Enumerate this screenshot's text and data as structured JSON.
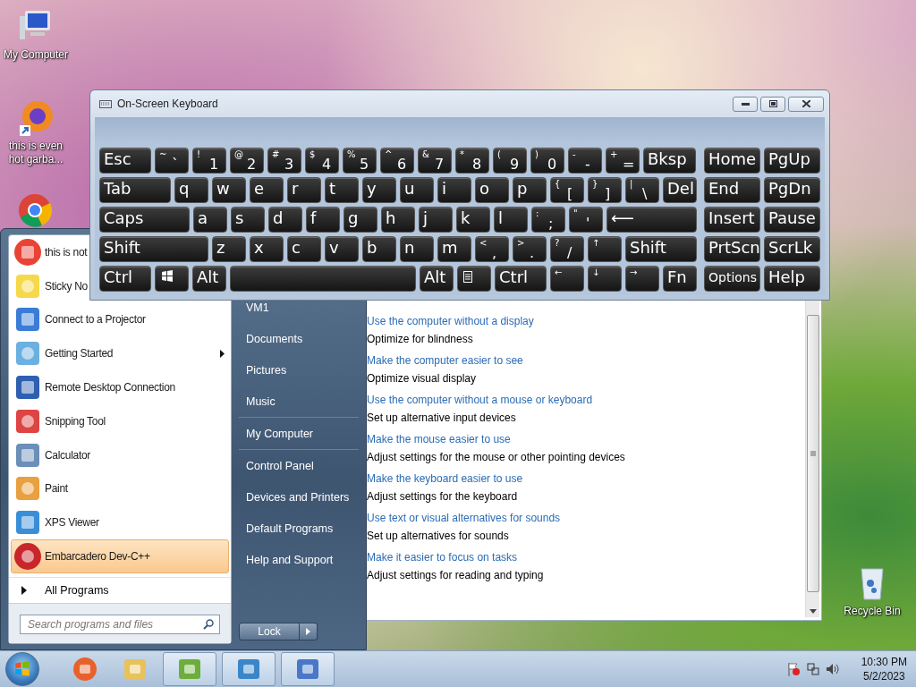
{
  "desktop": {
    "icons": [
      {
        "label": "My Computer"
      },
      {
        "label": "this is even hot garba..."
      },
      {
        "label": "Recycle Bin"
      }
    ]
  },
  "accessibility_window": {
    "items": [
      {
        "link": "Use the computer without a display",
        "description": "Optimize for blindness"
      },
      {
        "link": "Make the computer easier to see",
        "description": "Optimize visual display"
      },
      {
        "link": "Use the computer without a mouse or keyboard",
        "description": "Set up alternative input devices"
      },
      {
        "link": "Make the mouse easier to use",
        "description": "Adjust settings for the mouse or other pointing devices"
      },
      {
        "link": "Make the keyboard easier to use",
        "description": "Adjust settings for the keyboard"
      },
      {
        "link": "Use text or visual alternatives for sounds",
        "description": "Set up alternatives for sounds"
      },
      {
        "link": "Make it easier to focus on tasks",
        "description": "Adjust settings for reading and typing"
      }
    ]
  },
  "start_menu": {
    "programs": [
      {
        "label": "this is not",
        "selected": false,
        "has_submenu": false
      },
      {
        "label": "Sticky No",
        "selected": false,
        "has_submenu": false
      },
      {
        "label": "Connect to a Projector",
        "selected": false,
        "has_submenu": false
      },
      {
        "label": "Getting Started",
        "selected": false,
        "has_submenu": true
      },
      {
        "label": "Remote Desktop Connection",
        "selected": false,
        "has_submenu": false
      },
      {
        "label": "Snipping Tool",
        "selected": false,
        "has_submenu": false
      },
      {
        "label": "Calculator",
        "selected": false,
        "has_submenu": false
      },
      {
        "label": "Paint",
        "selected": false,
        "has_submenu": false
      },
      {
        "label": "XPS Viewer",
        "selected": false,
        "has_submenu": false
      },
      {
        "label": "Embarcadero Dev-C++",
        "selected": true,
        "has_submenu": false
      }
    ],
    "all_programs": "All Programs",
    "search": {
      "placeholder": "Search programs and files"
    },
    "places": [
      {
        "label": "VM1",
        "separator_before": false
      },
      {
        "label": "Documents",
        "separator_before": false
      },
      {
        "label": "Pictures",
        "separator_before": false
      },
      {
        "label": "Music",
        "separator_before": false
      },
      {
        "label": "My Computer",
        "separator_before": true
      },
      {
        "label": "Control Panel",
        "separator_before": true
      },
      {
        "label": "Devices and Printers",
        "separator_before": false
      },
      {
        "label": "Default Programs",
        "separator_before": false
      },
      {
        "label": "Help and Support",
        "separator_before": false
      }
    ],
    "lock_button": "Lock"
  },
  "keyboard_window": {
    "title": "On-Screen Keyboard",
    "main_rows": [
      [
        {
          "kind": "text",
          "label": "Esc"
        },
        {
          "kind": "dual",
          "shift": "~",
          "label": "`"
        },
        {
          "kind": "dual",
          "shift": "!",
          "label": "1"
        },
        {
          "kind": "dual",
          "shift": "@",
          "label": "2"
        },
        {
          "kind": "dual",
          "shift": "#",
          "label": "3"
        },
        {
          "kind": "dual",
          "shift": "$",
          "label": "4"
        },
        {
          "kind": "dual",
          "shift": "%",
          "label": "5"
        },
        {
          "kind": "dual",
          "shift": "^",
          "label": "6"
        },
        {
          "kind": "dual",
          "shift": "&",
          "label": "7"
        },
        {
          "kind": "dual",
          "shift": "*",
          "label": "8"
        },
        {
          "kind": "dual",
          "shift": "(",
          "label": "9"
        },
        {
          "kind": "dual",
          "shift": ")",
          "label": "0"
        },
        {
          "kind": "dual",
          "shift": "-",
          "label": "-"
        },
        {
          "kind": "dual",
          "shift": "+",
          "label": "="
        },
        {
          "kind": "text",
          "label": "Bksp"
        }
      ],
      [
        {
          "kind": "text",
          "label": "Tab"
        },
        {
          "kind": "text",
          "label": "q"
        },
        {
          "kind": "text",
          "label": "w"
        },
        {
          "kind": "text",
          "label": "e"
        },
        {
          "kind": "text",
          "label": "r"
        },
        {
          "kind": "text",
          "label": "t"
        },
        {
          "kind": "text",
          "label": "y"
        },
        {
          "kind": "text",
          "label": "u"
        },
        {
          "kind": "text",
          "label": "i"
        },
        {
          "kind": "text",
          "label": "o"
        },
        {
          "kind": "text",
          "label": "p"
        },
        {
          "kind": "dual",
          "shift": "{",
          "label": "["
        },
        {
          "kind": "dual",
          "shift": "}",
          "label": "]"
        },
        {
          "kind": "dual",
          "shift": "|",
          "label": "\\"
        },
        {
          "kind": "text",
          "label": "Del"
        }
      ],
      [
        {
          "kind": "text",
          "label": "Caps"
        },
        {
          "kind": "text",
          "label": "a"
        },
        {
          "kind": "text",
          "label": "s"
        },
        {
          "kind": "text",
          "label": "d"
        },
        {
          "kind": "text",
          "label": "f"
        },
        {
          "kind": "text",
          "label": "g"
        },
        {
          "kind": "text",
          "label": "h"
        },
        {
          "kind": "text",
          "label": "j"
        },
        {
          "kind": "text",
          "label": "k"
        },
        {
          "kind": "text",
          "label": "l"
        },
        {
          "kind": "dual",
          "shift": ":",
          "label": ";"
        },
        {
          "kind": "dual",
          "shift": "\"",
          "label": "'"
        },
        {
          "kind": "text",
          "label": "⟵"
        }
      ],
      [
        {
          "kind": "text",
          "label": "Shift"
        },
        {
          "kind": "text",
          "label": "z"
        },
        {
          "kind": "text",
          "label": "x"
        },
        {
          "kind": "text",
          "label": "c"
        },
        {
          "kind": "text",
          "label": "v"
        },
        {
          "kind": "text",
          "label": "b"
        },
        {
          "kind": "text",
          "label": "n"
        },
        {
          "kind": "text",
          "label": "m"
        },
        {
          "kind": "dual",
          "shift": "<",
          "label": ","
        },
        {
          "kind": "dual",
          "shift": ">",
          "label": "."
        },
        {
          "kind": "dual",
          "shift": "?",
          "label": "/"
        },
        {
          "kind": "arrow",
          "label": "↑"
        },
        {
          "kind": "text",
          "label": "Shift"
        }
      ],
      [
        {
          "kind": "text",
          "label": "Ctrl"
        },
        {
          "kind": "win"
        },
        {
          "kind": "text",
          "label": "Alt"
        },
        {
          "kind": "space"
        },
        {
          "kind": "text",
          "label": "Alt"
        },
        {
          "kind": "menu"
        },
        {
          "kind": "text",
          "label": "Ctrl"
        },
        {
          "kind": "arrow",
          "label": "←"
        },
        {
          "kind": "arrow",
          "label": "↓"
        },
        {
          "kind": "arrow",
          "label": "→"
        },
        {
          "kind": "text",
          "label": "Fn"
        }
      ]
    ],
    "nav_rows": [
      [
        {
          "kind": "text",
          "label": "Home"
        },
        {
          "kind": "text",
          "label": "PgUp"
        }
      ],
      [
        {
          "kind": "text",
          "label": "End"
        },
        {
          "kind": "text",
          "label": "PgDn"
        }
      ],
      [
        {
          "kind": "text",
          "label": "Insert"
        },
        {
          "kind": "text",
          "label": "Pause"
        }
      ],
      [
        {
          "kind": "text",
          "label": "PrtScn"
        },
        {
          "kind": "text",
          "label": "ScrLk"
        }
      ],
      [
        {
          "kind": "small",
          "label": "Options"
        },
        {
          "kind": "text",
          "label": "Help"
        }
      ]
    ]
  },
  "taskbar": {
    "apps": [
      {
        "running": false
      },
      {
        "running": false
      },
      {
        "running": true
      },
      {
        "running": true
      },
      {
        "running": true
      }
    ],
    "clock": {
      "time": "10:30 PM",
      "date": "5/2/2023"
    }
  }
}
